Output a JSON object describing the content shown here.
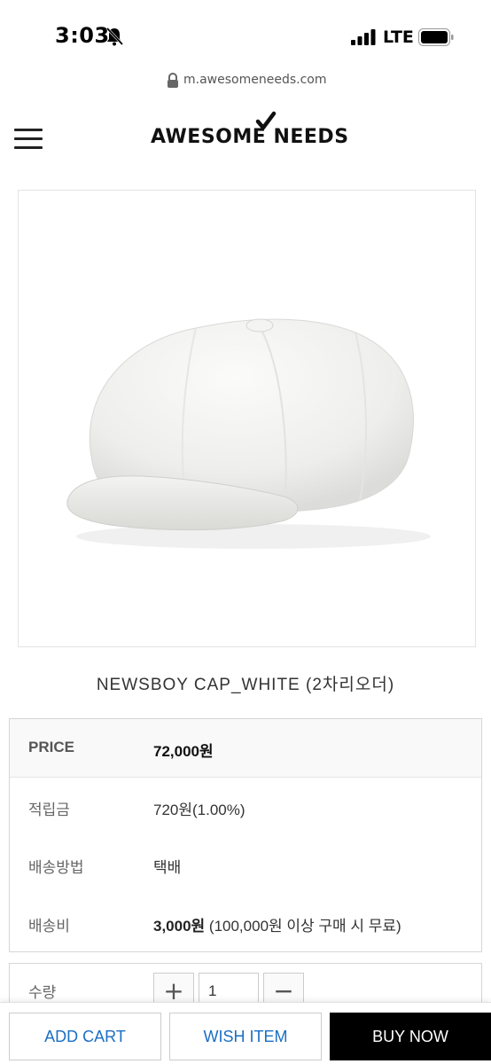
{
  "status_bar": {
    "time": "3:03",
    "network": "LTE"
  },
  "browser": {
    "url": "m.awesomeneeds.com"
  },
  "header": {
    "logo_text": "AWESOME NEEDS"
  },
  "product": {
    "name": "NEWSBOY CAP_WHITE (2차리오더)"
  },
  "info": {
    "price_label": "PRICE",
    "price_value": "72,000원",
    "points_label": "적립금",
    "points_value": "720원(1.00%)",
    "shipping_method_label": "배송방법",
    "shipping_method_value": "택배",
    "shipping_fee_label": "배송비",
    "shipping_fee_value": "3,000원",
    "shipping_fee_note": " (100,000원 이상 구매 시 무료)"
  },
  "quantity": {
    "label": "수량",
    "value": "1",
    "plus": "+",
    "minus": "−"
  },
  "actions": {
    "add_cart": "ADD CART",
    "wish_item": "WISH ITEM",
    "buy_now": "BUY NOW"
  },
  "colors": {
    "accent_link": "#1a6fc4",
    "buy_button": "#000000"
  }
}
